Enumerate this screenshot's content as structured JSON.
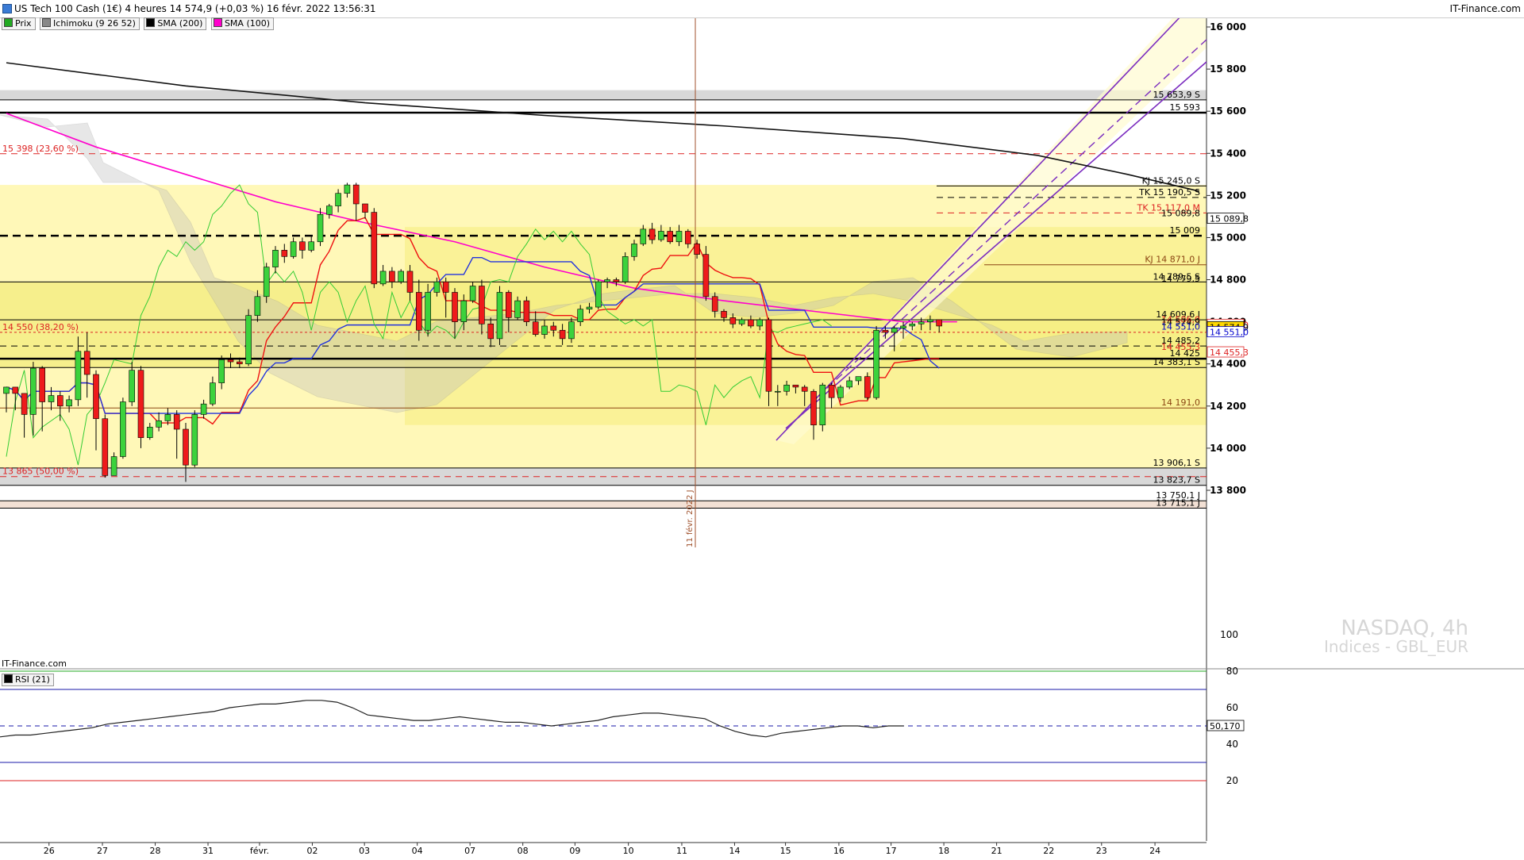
{
  "header": {
    "title": "US Tech 100 Cash (1€) 4 heures 14 574,9 (+0,03 %) 16 févr. 2022 13:56:31",
    "brand": "IT-Finance.com"
  },
  "legend": [
    {
      "label": "Prix",
      "color": "#22aa22"
    },
    {
      "label": "Ichimoku (9 26 52)",
      "color": "#888888"
    },
    {
      "label": "SMA (200)",
      "color": "#000000"
    },
    {
      "label": "SMA (100)",
      "color": "#ff00cc"
    }
  ],
  "watermark": {
    "line1": "NASDAQ, 4h",
    "line2": "Indices - GBL_EUR"
  },
  "price_footer": "IT-Finance.com",
  "vertical_marker_label": "11 févr. 2022 J",
  "rsi": {
    "label": "RSI (21)",
    "current": "50,170"
  },
  "chart_data": [
    {
      "type": "candlestick",
      "title": "US Tech 100 Cash (1€) 4 heures",
      "x_categories": [
        "26",
        "27",
        "28",
        "31",
        "févr.",
        "02",
        "03",
        "04",
        "07",
        "08",
        "09",
        "10",
        "11",
        "14",
        "15",
        "16",
        "17",
        "18",
        "21",
        "22",
        "23",
        "24"
      ],
      "y_ticks": [
        "16 000",
        "15 800",
        "15 600",
        "15 400",
        "15 200",
        "15 000",
        "14 800",
        "14 600",
        "14 400",
        "14 200",
        "14 000",
        "13 800"
      ],
      "ylim": [
        13680,
        16120
      ],
      "candles": [
        [
          14260,
          14290,
          14170,
          14290
        ],
        [
          14290,
          14260,
          14180,
          14290
        ],
        [
          14260,
          14160,
          14050,
          14260
        ],
        [
          14160,
          14380,
          14060,
          14410
        ],
        [
          14380,
          14220,
          14080,
          14390
        ],
        [
          14220,
          14250,
          14180,
          14290
        ],
        [
          14250,
          14200,
          14130,
          14270
        ],
        [
          14200,
          14230,
          14170,
          14250
        ],
        [
          14230,
          14460,
          14200,
          14530
        ],
        [
          14460,
          14350,
          14240,
          14550
        ],
        [
          14350,
          14140,
          13990,
          14370
        ],
        [
          14140,
          13870,
          13860,
          14160
        ],
        [
          13870,
          13960,
          13900,
          13980
        ],
        [
          13960,
          14220,
          13950,
          14240
        ],
        [
          14220,
          14370,
          14200,
          14410
        ],
        [
          14370,
          14050,
          14000,
          14390
        ],
        [
          14050,
          14100,
          14040,
          14120
        ],
        [
          14100,
          14130,
          14080,
          14170
        ],
        [
          14130,
          14160,
          14110,
          14190
        ],
        [
          14160,
          14090,
          13950,
          14180
        ],
        [
          14090,
          13920,
          13840,
          14120
        ],
        [
          13920,
          14160,
          13910,
          14180
        ],
        [
          14160,
          14210,
          14140,
          14230
        ],
        [
          14210,
          14310,
          14200,
          14340
        ],
        [
          14310,
          14420,
          14280,
          14440
        ],
        [
          14420,
          14410,
          14380,
          14450
        ],
        [
          14410,
          14400,
          14380,
          14430
        ],
        [
          14400,
          14630,
          14390,
          14660
        ],
        [
          14630,
          14720,
          14600,
          14750
        ],
        [
          14720,
          14860,
          14690,
          14880
        ],
        [
          14860,
          14940,
          14830,
          14960
        ],
        [
          14940,
          14910,
          14880,
          14970
        ],
        [
          14910,
          14980,
          14900,
          15000
        ],
        [
          14980,
          14940,
          14900,
          15000
        ],
        [
          14940,
          14980,
          14930,
          15010
        ],
        [
          14980,
          15110,
          14960,
          15140
        ],
        [
          15110,
          15150,
          15090,
          15160
        ],
        [
          15150,
          15210,
          15120,
          15230
        ],
        [
          15210,
          15250,
          15190,
          15260
        ],
        [
          15250,
          15160,
          15080,
          15260
        ],
        [
          15160,
          15120,
          15090,
          15160
        ],
        [
          15120,
          14780,
          14760,
          15140
        ],
        [
          14780,
          14840,
          14770,
          14870
        ],
        [
          14840,
          14790,
          14760,
          14860
        ],
        [
          14790,
          14840,
          14780,
          14850
        ],
        [
          14840,
          14740,
          14700,
          14870
        ],
        [
          14740,
          14560,
          14510,
          14800
        ],
        [
          14560,
          14740,
          14530,
          14780
        ],
        [
          14740,
          14790,
          14720,
          14810
        ],
        [
          14790,
          14740,
          14620,
          14810
        ],
        [
          14740,
          14600,
          14520,
          14760
        ],
        [
          14600,
          14700,
          14560,
          14730
        ],
        [
          14700,
          14770,
          14690,
          14790
        ],
        [
          14770,
          14590,
          14540,
          14800
        ],
        [
          14590,
          14520,
          14480,
          14620
        ],
        [
          14520,
          14740,
          14490,
          14770
        ],
        [
          14740,
          14620,
          14550,
          14750
        ],
        [
          14620,
          14700,
          14610,
          14720
        ],
        [
          14700,
          14600,
          14580,
          14720
        ],
        [
          14600,
          14540,
          14530,
          14650
        ],
        [
          14540,
          14580,
          14520,
          14610
        ],
        [
          14580,
          14560,
          14530,
          14600
        ],
        [
          14560,
          14520,
          14490,
          14590
        ],
        [
          14520,
          14600,
          14500,
          14620
        ],
        [
          14600,
          14660,
          14580,
          14680
        ],
        [
          14660,
          14670,
          14640,
          14690
        ],
        [
          14670,
          14790,
          14660,
          14800
        ],
        [
          14790,
          14800,
          14760,
          14810
        ],
        [
          14800,
          14790,
          14770,
          14810
        ],
        [
          14790,
          14910,
          14780,
          14930
        ],
        [
          14910,
          14970,
          14890,
          14990
        ],
        [
          14970,
          15040,
          14960,
          15060
        ],
        [
          15040,
          14990,
          14970,
          15070
        ],
        [
          14990,
          15030,
          14980,
          15060
        ],
        [
          15030,
          14980,
          14970,
          15050
        ],
        [
          14980,
          15030,
          14960,
          15060
        ],
        [
          15030,
          14970,
          14950,
          15040
        ],
        [
          14970,
          14920,
          14900,
          14990
        ],
        [
          14920,
          14720,
          14700,
          14960
        ],
        [
          14720,
          14650,
          14620,
          14740
        ],
        [
          14650,
          14620,
          14600,
          14660
        ],
        [
          14620,
          14590,
          14570,
          14640
        ],
        [
          14590,
          14610,
          14580,
          14620
        ],
        [
          14610,
          14580,
          14570,
          14630
        ],
        [
          14580,
          14610,
          14560,
          14620
        ],
        [
          14610,
          14270,
          14200,
          14620
        ],
        [
          14270,
          14270,
          14200,
          14300
        ],
        [
          14270,
          14300,
          14250,
          14320
        ],
        [
          14300,
          14290,
          14260,
          14300
        ],
        [
          14290,
          14270,
          14200,
          14300
        ],
        [
          14270,
          14110,
          14040,
          14280
        ],
        [
          14110,
          14300,
          14080,
          14310
        ],
        [
          14300,
          14240,
          14190,
          14310
        ],
        [
          14240,
          14290,
          14220,
          14300
        ],
        [
          14290,
          14320,
          14280,
          14340
        ],
        [
          14320,
          14340,
          14300,
          14340
        ],
        [
          14340,
          14240,
          14230,
          14360
        ],
        [
          14240,
          14560,
          14230,
          14580
        ],
        [
          14560,
          14550,
          14520,
          14580
        ],
        [
          14550,
          14570,
          14460,
          14580
        ],
        [
          14570,
          14580,
          14520,
          14600
        ],
        [
          14580,
          14590,
          14560,
          14600
        ],
        [
          14590,
          14600,
          14560,
          14620
        ],
        [
          14600,
          14610,
          14560,
          14630
        ],
        [
          14610,
          14580,
          14550,
          14610
        ]
      ],
      "levels": [
        {
          "y": 15653.9,
          "label": "15 653,9 S",
          "style": "solid",
          "color": "#000"
        },
        {
          "y": 15593,
          "label": "15 593",
          "style": "solid-thick",
          "color": "#000"
        },
        {
          "y": 15398,
          "label": "15 398 (23,60 %)",
          "style": "dashed",
          "color": "#dd2222"
        },
        {
          "y": 15245,
          "label": "KJ 15 245,0 S",
          "style": "solid",
          "color": "#000"
        },
        {
          "y": 15190.5,
          "label": "TK 15 190,5 S",
          "style": "dashed",
          "color": "#000"
        },
        {
          "y": 15117,
          "label": "TK 15 117,0 M",
          "style": "dashed",
          "color": "#dd2222"
        },
        {
          "y": 15089.8,
          "label": "15 089,8",
          "style": "none",
          "color": "#000"
        },
        {
          "y": 15009,
          "label": "15 009",
          "style": "dashed-thick",
          "color": "#000"
        },
        {
          "y": 14871,
          "label": "KJ 14 871,0 J",
          "style": "solid",
          "color": "#8b4513"
        },
        {
          "y": 14789.5,
          "label": "14 789,5 S",
          "style": "solid",
          "color": "#000"
        },
        {
          "y": 14779.5,
          "label": "14 779,5",
          "style": "none",
          "color": "#000"
        },
        {
          "y": 14609.6,
          "label": "14 609,6 J",
          "style": "solid",
          "color": "#000"
        },
        {
          "y": 14586,
          "label": "14 586,0",
          "style": "none",
          "color": "#dd2222"
        },
        {
          "y": 14574.9,
          "label": "14 574,9",
          "style": "none",
          "color": "#000"
        },
        {
          "y": 14551,
          "label": "14 551,0",
          "style": "none",
          "color": "#0000cc"
        },
        {
          "y": 14550,
          "label": "14 550 (38,20 %)",
          "style": "dotted",
          "color": "#dd2222"
        },
        {
          "y": 14485.2,
          "label": "14 485,2",
          "style": "dashed",
          "color": "#000"
        },
        {
          "y": 14455.3,
          "label": "14 455,3",
          "style": "none",
          "color": "#dd2222"
        },
        {
          "y": 14425,
          "label": "14 425",
          "style": "solid-thick",
          "color": "#000"
        },
        {
          "y": 14383.1,
          "label": "14 383,1 S",
          "style": "solid",
          "color": "#000"
        },
        {
          "y": 14191,
          "label": "14 191,0",
          "style": "solid",
          "color": "#8b4513"
        },
        {
          "y": 13906.1,
          "label": "13 906,1 S",
          "style": "solid",
          "color": "#000"
        },
        {
          "y": 13865,
          "label": "13 865 (50,00 %)",
          "style": "dashed",
          "color": "#dd2222"
        },
        {
          "y": 13823.7,
          "label": "13 823,7 S",
          "style": "solid",
          "color": "#000"
        },
        {
          "y": 13750.1,
          "label": "13 750,1 J",
          "style": "solid",
          "color": "#000"
        },
        {
          "y": 13715.1,
          "label": "13 715,1 J",
          "style": "solid",
          "color": "#000"
        }
      ],
      "sma200": [
        [
          0,
          15830
        ],
        [
          20,
          15720
        ],
        [
          40,
          15640
        ],
        [
          60,
          15580
        ],
        [
          80,
          15530
        ],
        [
          100,
          15470
        ],
        [
          115,
          15390
        ],
        [
          125,
          15300
        ],
        [
          133,
          15220
        ]
      ],
      "sma100": [
        [
          0,
          15590
        ],
        [
          10,
          15430
        ],
        [
          20,
          15300
        ],
        [
          30,
          15170
        ],
        [
          40,
          15070
        ],
        [
          50,
          14980
        ],
        [
          60,
          14860
        ],
        [
          70,
          14760
        ],
        [
          80,
          14700
        ],
        [
          90,
          14650
        ],
        [
          100,
          14600
        ],
        [
          106,
          14600
        ]
      ],
      "rsi_values": [
        44,
        45,
        45,
        46,
        47,
        48,
        49,
        51,
        52,
        53,
        54,
        55,
        56,
        57,
        58,
        60,
        61,
        62,
        62,
        63,
        64,
        64,
        63,
        60,
        56,
        55,
        54,
        53,
        53,
        54,
        55,
        54,
        53,
        52,
        52,
        51,
        50,
        51,
        52,
        53,
        55,
        56,
        57,
        57,
        56,
        55,
        54,
        50,
        47,
        45,
        44,
        46,
        47,
        48,
        49,
        50,
        50,
        49,
        50,
        50
      ],
      "rsi_ylim": [
        0,
        100
      ],
      "rsi_ticks": [
        "100",
        "80",
        "60",
        "40",
        "20"
      ]
    }
  ]
}
